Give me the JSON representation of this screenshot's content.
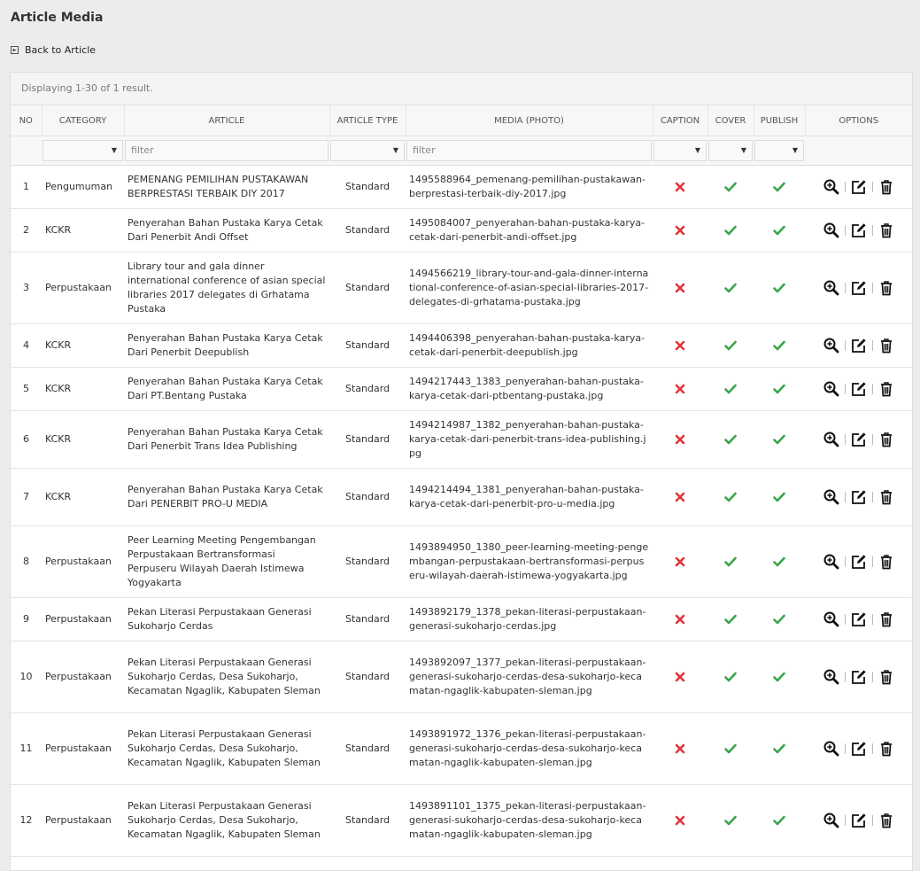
{
  "page": {
    "title": "Article Media",
    "back_label": "Back to Article"
  },
  "summary": "Displaying 1-30 of 1 result.",
  "columns": {
    "no": "NO",
    "category": "CATEGORY",
    "article": "ARTICLE",
    "article_type": "ARTICLE TYPE",
    "media": "MEDIA (PHOTO)",
    "caption": "CAPTION",
    "cover": "COVER",
    "publish": "PUBLISH",
    "options": "OPTIONS"
  },
  "filters": {
    "article_placeholder": "filter",
    "media_placeholder": "filter"
  },
  "colors": {
    "no_mark": "#e0343a",
    "yes_mark": "#3aa54a"
  },
  "rows": [
    {
      "no": "1",
      "category": "Pengumuman",
      "article": "PEMENANG PEMILIHAN PUSTAKAWAN BERPRESTASI TERBAIK DIY 2017",
      "type": "Standard",
      "media": "1495588964_pemenang-pemilihan-pustakawan-berprestasi-terbaik-diy-2017.jpg",
      "caption": false,
      "cover": true,
      "publish": true
    },
    {
      "no": "2",
      "category": "KCKR",
      "article": "Penyerahan Bahan Pustaka Karya Cetak Dari Penerbit Andi Offset",
      "type": "Standard",
      "media": "1495084007_penyerahan-bahan-pustaka-karya-cetak-dari-penerbit-andi-offset.jpg",
      "caption": false,
      "cover": true,
      "publish": true
    },
    {
      "no": "3",
      "category": "Perpustakaan",
      "article": "Library tour and gala dinner international conference of asian special libraries 2017 delegates di Grhatama Pustaka",
      "type": "Standard",
      "media": "1494566219_library-tour-and-gala-dinner-international-conference-of-asian-special-libraries-2017-delegates-di-grhatama-pustaka.jpg",
      "caption": false,
      "cover": true,
      "publish": true
    },
    {
      "no": "4",
      "category": "KCKR",
      "article": "Penyerahan Bahan Pustaka Karya Cetak Dari Penerbit Deepublish",
      "type": "Standard",
      "media": "1494406398_penyerahan-bahan-pustaka-karya-cetak-dari-penerbit-deepublish.jpg",
      "caption": false,
      "cover": true,
      "publish": true
    },
    {
      "no": "5",
      "category": "KCKR",
      "article": "Penyerahan Bahan Pustaka Karya Cetak Dari PT.Bentang Pustaka",
      "type": "Standard",
      "media": "1494217443_1383_penyerahan-bahan-pustaka-karya-cetak-dari-ptbentang-pustaka.jpg",
      "caption": false,
      "cover": true,
      "publish": true
    },
    {
      "no": "6",
      "category": "KCKR",
      "article": "Penyerahan Bahan Pustaka Karya Cetak Dari Penerbit Trans Idea Publishing",
      "type": "Standard",
      "media": "1494214987_1382_penyerahan-bahan-pustaka-karya-cetak-dari-penerbit-trans-idea-publishing.jpg",
      "caption": false,
      "cover": true,
      "publish": true
    },
    {
      "no": "7",
      "category": "KCKR",
      "article": "Penyerahan Bahan Pustaka Karya Cetak Dari PENERBIT PRO-U MEDIA",
      "type": "Standard",
      "media": "1494214494_1381_penyerahan-bahan-pustaka-karya-cetak-dari-penerbit-pro-u-media.jpg",
      "caption": false,
      "cover": true,
      "publish": true
    },
    {
      "no": "8",
      "category": "Perpustakaan",
      "article": "Peer Learning Meeting Pengembangan Perpustakaan Bertransformasi Perpuseru Wilayah Daerah Istimewa Yogyakarta",
      "type": "Standard",
      "media": "1493894950_1380_peer-learning-meeting-pengembangan-perpustakaan-bertransformasi-perpuseru-wilayah-daerah-istimewa-yogyakarta.jpg",
      "caption": false,
      "cover": true,
      "publish": true
    },
    {
      "no": "9",
      "category": "Perpustakaan",
      "article": "Pekan Literasi Perpustakaan Generasi Sukoharjo Cerdas",
      "type": "Standard",
      "media": "1493892179_1378_pekan-literasi-perpustakaan-generasi-sukoharjo-cerdas.jpg",
      "caption": false,
      "cover": true,
      "publish": true
    },
    {
      "no": "10",
      "category": "Perpustakaan",
      "article": "Pekan Literasi Perpustakaan Generasi Sukoharjo Cerdas, Desa Sukoharjo, Kecamatan Ngaglik, Kabupaten Sleman",
      "type": "Standard",
      "media": "1493892097_1377_pekan-literasi-perpustakaan-generasi-sukoharjo-cerdas-desa-sukoharjo-kecamatan-ngaglik-kabupaten-sleman.jpg",
      "caption": false,
      "cover": true,
      "publish": true
    },
    {
      "no": "11",
      "category": "Perpustakaan",
      "article": "Pekan Literasi Perpustakaan Generasi Sukoharjo Cerdas, Desa Sukoharjo, Kecamatan Ngaglik, Kabupaten Sleman",
      "type": "Standard",
      "media": "1493891972_1376_pekan-literasi-perpustakaan-generasi-sukoharjo-cerdas-desa-sukoharjo-kecamatan-ngaglik-kabupaten-sleman.jpg",
      "caption": false,
      "cover": true,
      "publish": true
    },
    {
      "no": "12",
      "category": "Perpustakaan",
      "article": "Pekan Literasi Perpustakaan Generasi Sukoharjo Cerdas, Desa Sukoharjo, Kecamatan Ngaglik, Kabupaten Sleman",
      "type": "Standard",
      "media": "1493891101_1375_pekan-literasi-perpustakaan-generasi-sukoharjo-cerdas-desa-sukoharjo-kecamatan-ngaglik-kabupaten-sleman.jpg",
      "caption": false,
      "cover": true,
      "publish": true
    }
  ]
}
